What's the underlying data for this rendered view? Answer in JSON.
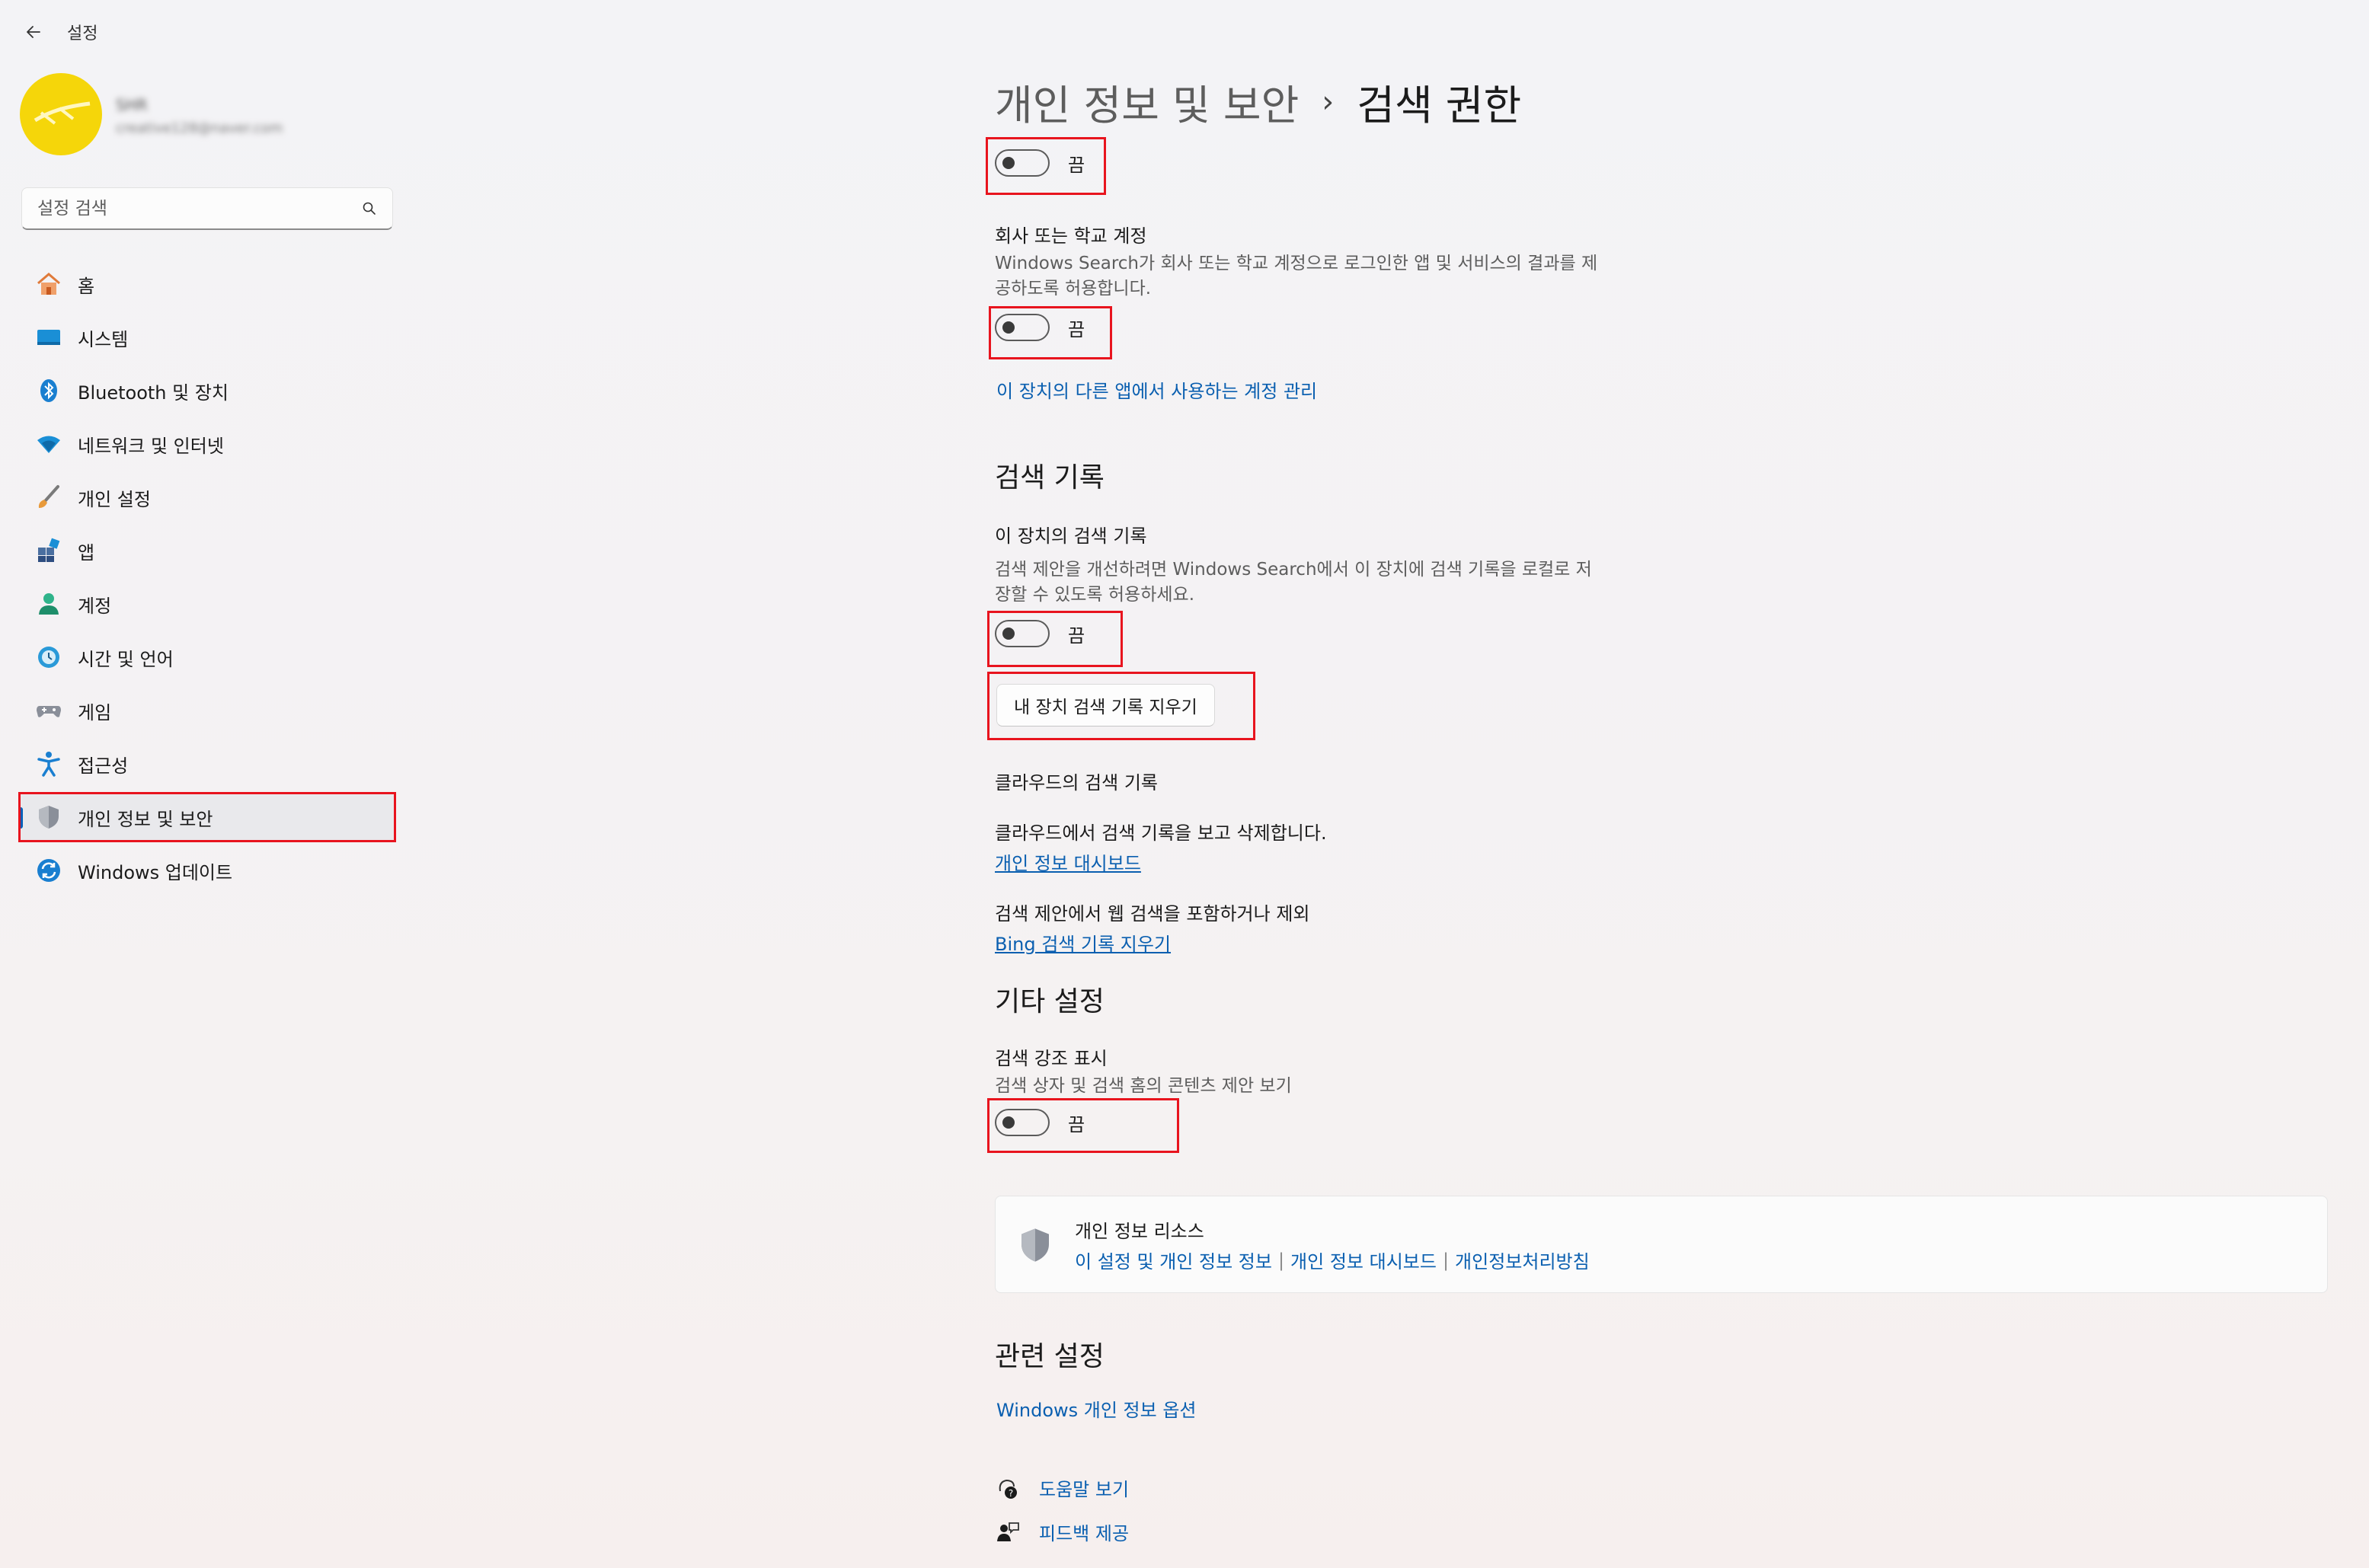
{
  "app": {
    "title": "설정"
  },
  "user": {
    "name": "SHR",
    "email": "creative128@naver.com"
  },
  "search": {
    "placeholder": "설정 검색"
  },
  "sidebar": {
    "items": [
      {
        "label": "홈",
        "icon": "home-icon"
      },
      {
        "label": "시스템",
        "icon": "system-icon"
      },
      {
        "label": "Bluetooth 및 장치",
        "icon": "bluetooth-icon"
      },
      {
        "label": "네트워크 및 인터넷",
        "icon": "wifi-icon"
      },
      {
        "label": "개인 설정",
        "icon": "brush-icon"
      },
      {
        "label": "앱",
        "icon": "apps-icon"
      },
      {
        "label": "계정",
        "icon": "account-icon"
      },
      {
        "label": "시간 및 언어",
        "icon": "clock-globe-icon"
      },
      {
        "label": "게임",
        "icon": "gamepad-icon"
      },
      {
        "label": "접근성",
        "icon": "accessibility-icon"
      },
      {
        "label": "개인 정보 및 보안",
        "icon": "shield-icon",
        "active": true
      },
      {
        "label": "Windows 업데이트",
        "icon": "update-icon"
      }
    ]
  },
  "breadcrumb": {
    "parent": "개인 정보 및 보안",
    "separator": "›",
    "current": "검색 권한"
  },
  "settings": {
    "toggle_top_state": "끔",
    "work_school": {
      "title": "회사 또는 학교 계정",
      "description": "Windows Search가 회사 또는 학교 계정으로 로그인한 앱 및 서비스의 결과를 제공하도록 허용합니다.",
      "state": "끔"
    },
    "manage_accounts_link": "이 장치의 다른 앱에서 사용하는 계정 관리",
    "history_section": "검색 기록",
    "device_history": {
      "title": "이 장치의 검색 기록",
      "description": "검색 제안을 개선하려면 Windows Search에서 이 장치에 검색 기록을 로컬로 저장할 수 있도록 허용하세요.",
      "state": "끔"
    },
    "clear_device_history_button": "내 장치 검색 기록 지우기",
    "cloud_history": {
      "title": "클라우드의 검색 기록",
      "description": "클라우드에서 검색 기록을 보고 삭제합니다.",
      "dashboard_link": "개인 정보 대시보드",
      "web_description": "검색 제안에서 웹 검색을 포함하거나 제외",
      "bing_link": "Bing 검색 기록 지우기"
    },
    "other_section": "기타 설정",
    "highlights": {
      "title": "검색 강조 표시",
      "description": "검색 상자 및 검색 홈의 콘텐츠 제안 보기",
      "state": "끔"
    }
  },
  "privacy_resources": {
    "title": "개인 정보 리소스",
    "links": [
      "이 설정 및 개인 정보 정보",
      "개인 정보 대시보드",
      "개인정보처리방침"
    ],
    "separator": "|"
  },
  "related": {
    "title": "관련 설정",
    "link": "Windows 개인 정보 옵션"
  },
  "footer": {
    "help": "도움말 보기",
    "feedback": "피드백 제공"
  },
  "colors": {
    "accent": "#005fb8",
    "link": "#0a5fb0",
    "highlight": "#e8141e",
    "avatar": "#f5d60a"
  }
}
